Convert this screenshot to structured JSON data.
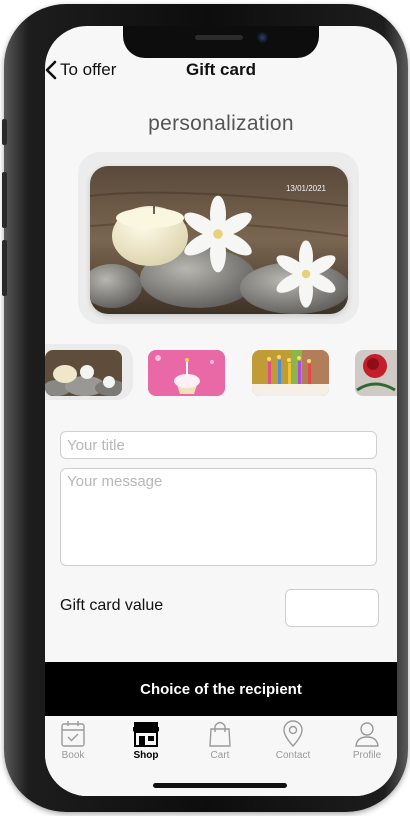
{
  "header": {
    "back_label": "To offer",
    "title": "Gift card"
  },
  "section_heading": "personalization",
  "card": {
    "date": "13/01/2021"
  },
  "thumbnails": [
    {
      "name": "candle-stones"
    },
    {
      "name": "pink-cupcake"
    },
    {
      "name": "birthday-candles"
    },
    {
      "name": "red-rose"
    }
  ],
  "form": {
    "title_placeholder": "Your title",
    "message_placeholder": "Your message",
    "value_label": "Gift card value"
  },
  "recipient_button": "Choice of the recipient",
  "tabs": [
    {
      "label": "Book",
      "icon": "calendar-icon",
      "active": false
    },
    {
      "label": "Shop",
      "icon": "store-icon",
      "active": true
    },
    {
      "label": "Cart",
      "icon": "bag-icon",
      "active": false
    },
    {
      "label": "Contact",
      "icon": "location-pin-icon",
      "active": false
    },
    {
      "label": "Profile",
      "icon": "person-icon",
      "active": false
    }
  ],
  "colors": {
    "bar": "#000000",
    "background": "#f7f7f7",
    "inactive_tab": "#9a9a9a"
  }
}
